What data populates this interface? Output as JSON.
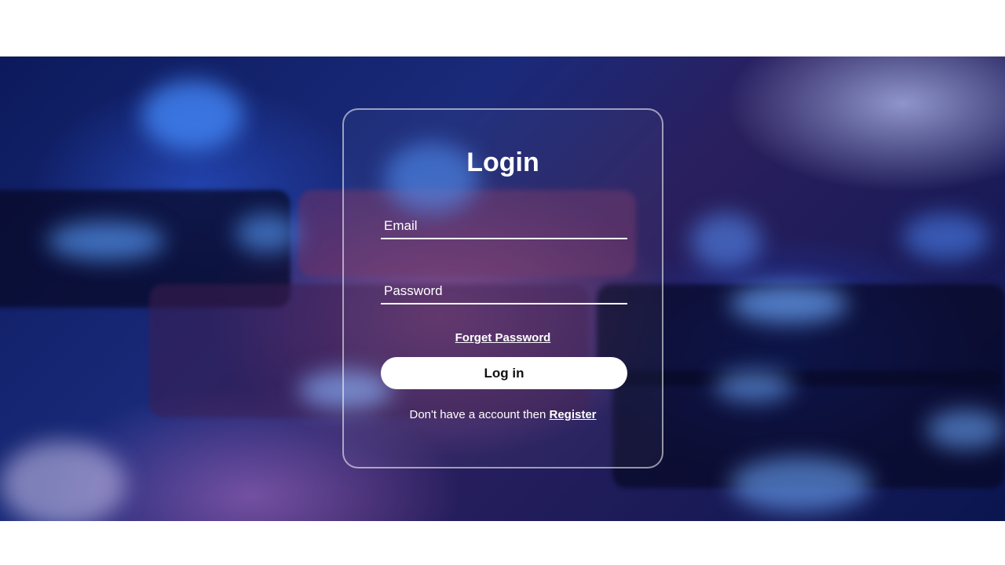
{
  "login": {
    "title": "Login",
    "email_placeholder": "Email",
    "password_placeholder": "Password",
    "forgot_label": "Forget Password",
    "login_button_label": "Log in",
    "register_prompt": "Don't have a account then",
    "register_link_label": "Register"
  },
  "colors": {
    "text": "#ffffff",
    "button_bg": "#ffffff",
    "button_text": "#111111",
    "card_border": "rgba(255,255,255,0.55)"
  }
}
